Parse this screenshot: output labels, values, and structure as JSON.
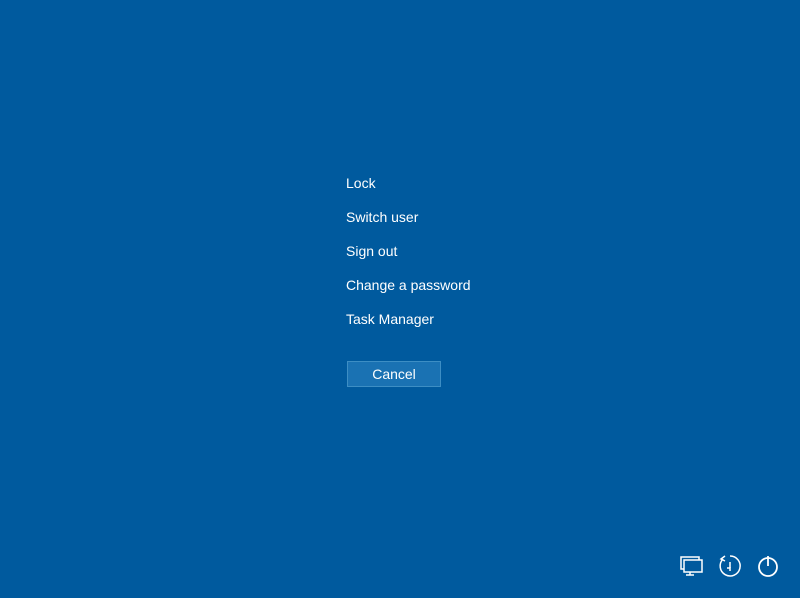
{
  "menu": {
    "lock": "Lock",
    "switch_user": "Switch user",
    "sign_out": "Sign out",
    "change_password": "Change a password",
    "task_manager": "Task Manager"
  },
  "cancel_label": "Cancel",
  "icons": {
    "network": "network-icon",
    "ease_of_access": "ease-of-access-icon",
    "power": "power-icon"
  }
}
